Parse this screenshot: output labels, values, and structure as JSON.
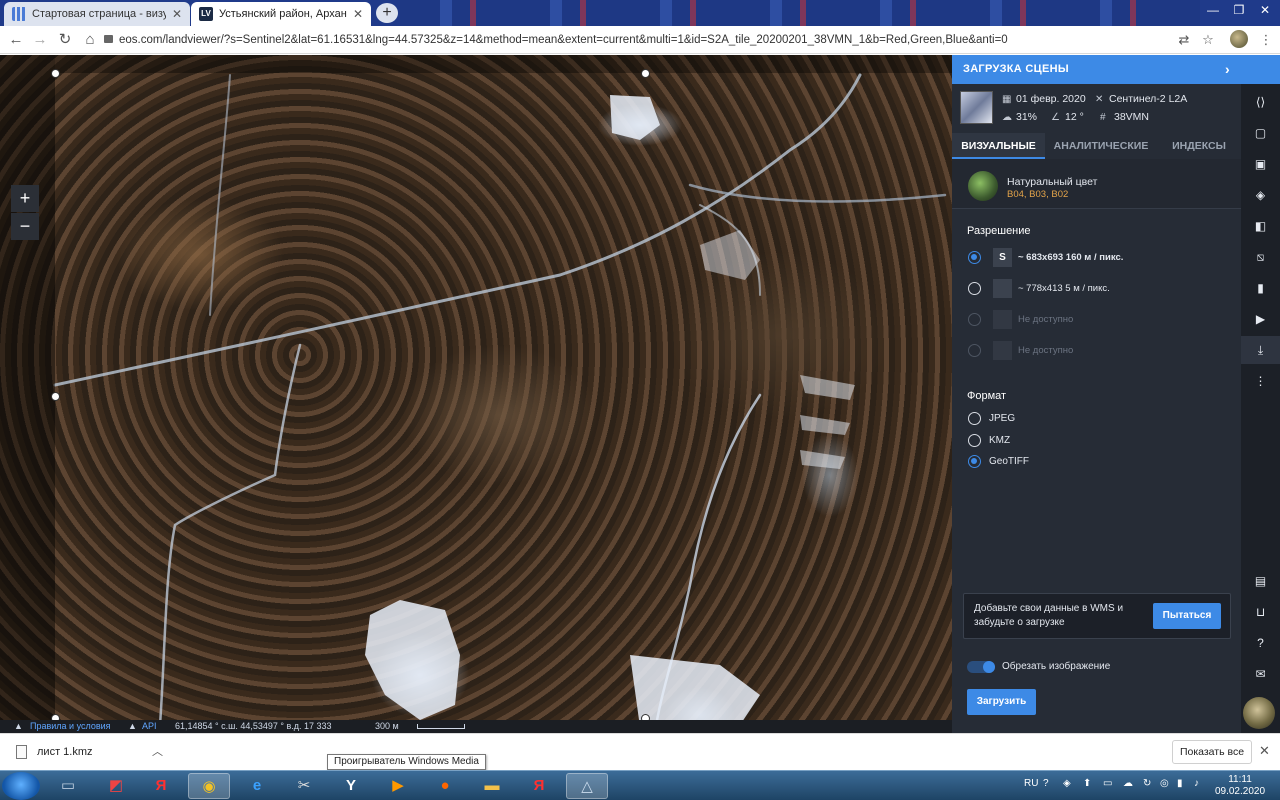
{
  "browser": {
    "tabs": [
      {
        "title": "Стартовая страница - визуальн",
        "active": false
      },
      {
        "title": "Устьянский район, Архангельс",
        "active": true
      }
    ],
    "url": "eos.com/landviewer/?s=Sentinel2&lat=61.16531&lng=44.57325&z=14&method=mean&extent=current&multi=1&id=S2A_tile_20200201_38VMN_1&b=Red,Green,Blue&anti=0"
  },
  "map": {
    "zoom_in": "+",
    "zoom_out": "−",
    "footer": {
      "terms_link": "Правила и условия",
      "api_link": "API",
      "coordinates": "61,14854 ° с.ш. 44,53497 ° в.д. 17 333",
      "scale_label": "300 м"
    }
  },
  "panel": {
    "header_title": "ЗАГРУЗКА СЦЕНЫ",
    "scene": {
      "date": "01 февр. 2020",
      "satellite": "Сентинел-2 L2A",
      "cloud_cover": "31%",
      "sun_angle": "12 °",
      "tile": "38VMN"
    },
    "tabs": [
      {
        "label": "ВИЗУАЛЬНЫЕ",
        "selected": true
      },
      {
        "label": "АНАЛИТИЧЕСКИЕ",
        "selected": false
      },
      {
        "label": "ИНДЕКСЫ",
        "selected": false
      }
    ],
    "preset": {
      "name": "Натуральный цвет",
      "bands": "B04, B03, B02"
    },
    "resolution_title": "Разрешение",
    "resolutions": [
      {
        "badge": "S",
        "label": "~ 683x693 160 м / пикс.",
        "state": "selected"
      },
      {
        "badge": "",
        "label": "~ 778x413 5 м / пикс.",
        "state": "available"
      },
      {
        "badge": "",
        "label": "Не доступно",
        "state": "disabled"
      },
      {
        "badge": "",
        "label": "Не доступно",
        "state": "disabled"
      }
    ],
    "format_title": "Формат",
    "formats": [
      {
        "label": "JPEG",
        "selected": false
      },
      {
        "label": "KMZ",
        "selected": false
      },
      {
        "label": "GeoTIFF",
        "selected": true
      }
    ],
    "wms_promo": {
      "text": "Добавьте свои данные в WMS и забудьте о загрузке",
      "button": "Пытаться"
    },
    "crop_label": "Обрезать изображение",
    "crop_enabled": true,
    "download_button": "Загрузить",
    "accent_color": "#3d8ae6"
  },
  "rail": {
    "icons": [
      "code-icon",
      "area-select-icon",
      "image-icon",
      "layers-icon",
      "compare-icon",
      "change-detection-icon",
      "chart-icon",
      "play-icon",
      "download-icon",
      "more-icon",
      "chat-icon",
      "cart-icon",
      "help-icon",
      "feedback-icon"
    ],
    "selected": "download-icon"
  },
  "shelf": {
    "file_name": "лист 1.kmz",
    "show_all": "Показать все",
    "tooltip": "Проигрыватель Windows Media"
  },
  "taskbar": {
    "language": "RU",
    "time": "11:11",
    "date": "09.02.2020"
  }
}
